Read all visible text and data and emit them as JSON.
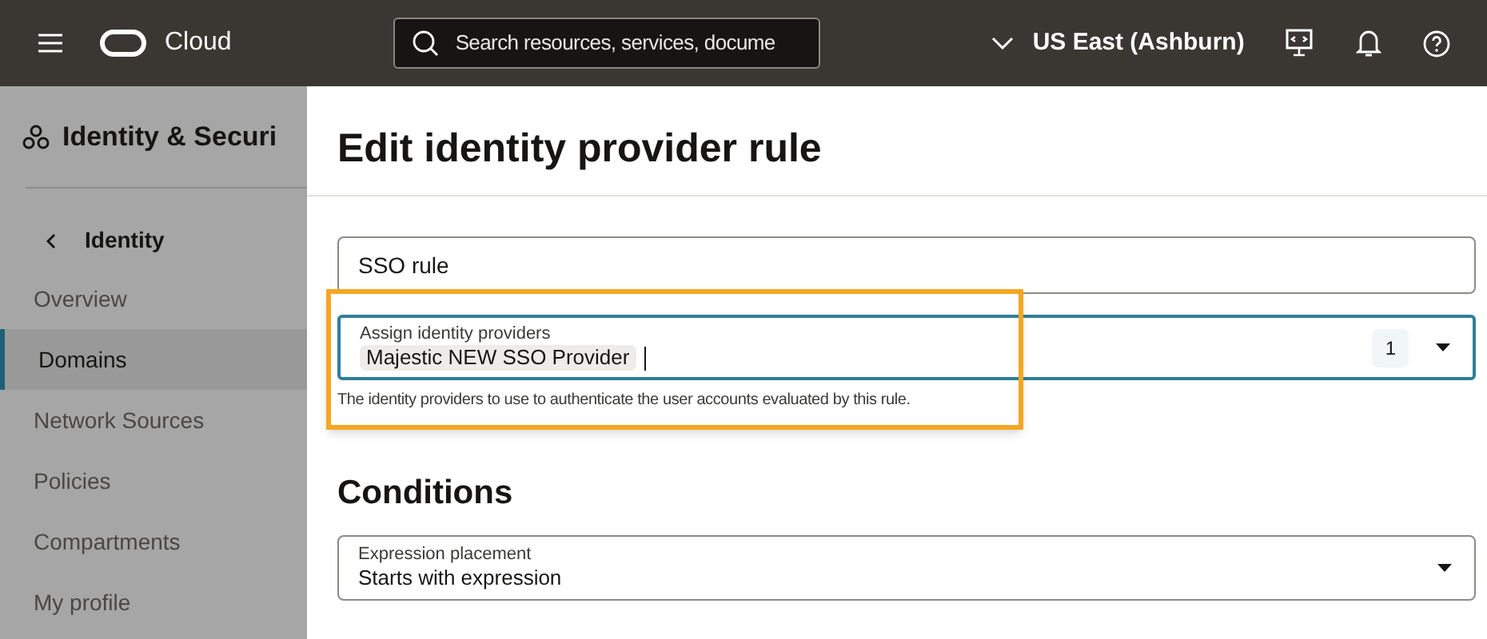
{
  "header": {
    "brand": "Cloud",
    "search": {
      "placeholder": "Search resources, services, docume"
    },
    "region": "US East (Ashburn)"
  },
  "sidebar": {
    "title": "Identity & Securi",
    "back": "Identity",
    "items": [
      {
        "label": "Overview",
        "selected": false
      },
      {
        "label": "Domains",
        "selected": true
      },
      {
        "label": "Network Sources",
        "selected": false
      },
      {
        "label": "Policies",
        "selected": false
      },
      {
        "label": "Compartments",
        "selected": false
      },
      {
        "label": "My profile",
        "selected": false
      }
    ]
  },
  "panel": {
    "title": "Edit identity provider rule",
    "name_field": {
      "value": "SSO rule"
    },
    "providers_field": {
      "label": "Assign identity providers",
      "chips": [
        "Majestic NEW SSO Provider"
      ],
      "count": "1",
      "help": "The identity providers to use to authenticate the user accounts evaluated by this rule.",
      "highlighted": true
    },
    "conditions": {
      "heading": "Conditions",
      "field": {
        "label": "Expression placement",
        "value": "Starts with expression"
      }
    }
  }
}
